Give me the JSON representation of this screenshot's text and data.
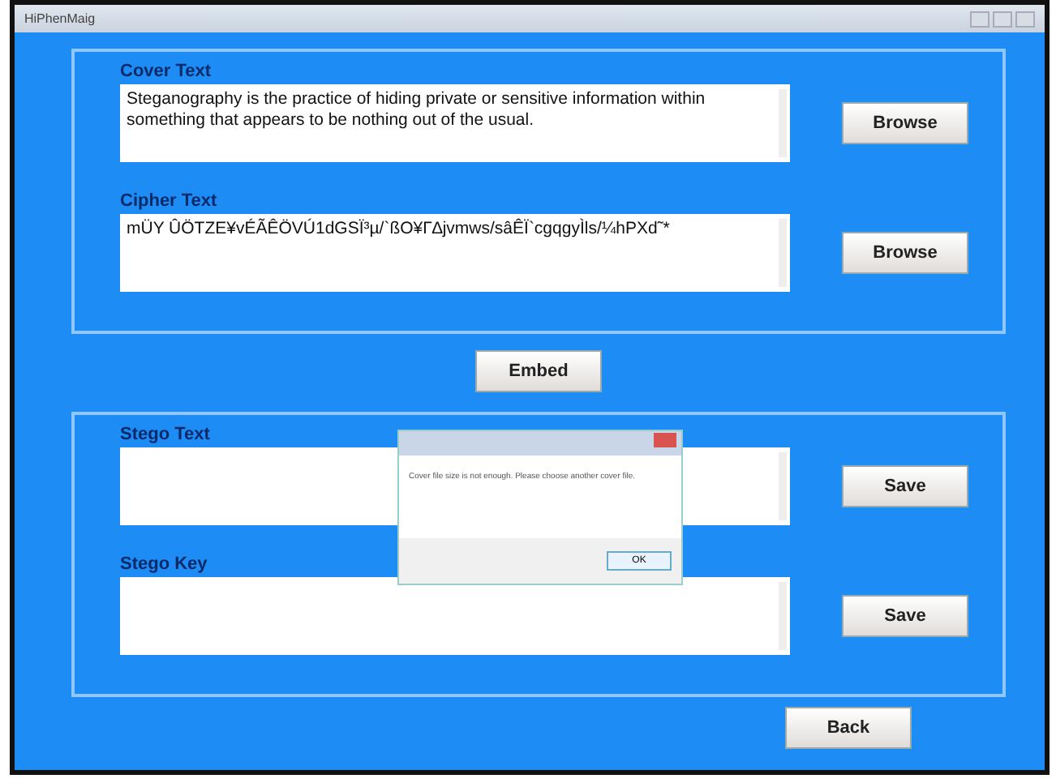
{
  "window": {
    "title": "HiPhenMaig"
  },
  "cover": {
    "label": "Cover Text",
    "value": "Steganography is the practice of hiding private or sensitive information within something that appears to be nothing out of the usual.",
    "button": "Browse"
  },
  "cipher": {
    "label": "Cipher Text",
    "value": "mÜY ÛÖTZE¥vÉÃÊÖVÚ1dGSÏ³µ/`ßO¥Γ∆jvmws/sâÊΪ`cgqgyÌls/¼hPXd˜*",
    "button": "Browse"
  },
  "embed": "Embed",
  "stego_text": {
    "label": "Stego Text",
    "button": "Save"
  },
  "stego_key": {
    "label": "Stego Key",
    "button": "Save"
  },
  "back": "Back",
  "dialog": {
    "message": "Cover file size is not enough. Please choose another cover file.",
    "ok": "OK"
  }
}
